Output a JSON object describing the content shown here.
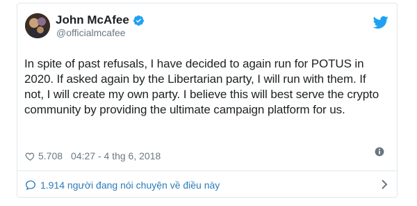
{
  "tweet": {
    "author_name": "John McAfee",
    "author_handle": "@officialmcafee",
    "text": "In spite of past refusals, I have decided to again run for POTUS in 2020. If asked again by the Libertarian party, I will run with them. If not, I will create my own party. I believe this will best serve the crypto community by providing the ultimate campaign platform for us.",
    "likes": "5.708",
    "timestamp": "04:27 - 4 thg 6, 2018",
    "conversation": "1.914 người đang nói chuyện về điều này"
  },
  "icons": {
    "verified": "verified-badge-icon",
    "brand": "twitter-bird-icon",
    "like": "heart-icon",
    "info": "info-icon",
    "reply": "speech-bubble-icon",
    "chevron": "chevron-right-icon"
  },
  "colors": {
    "accent": "#1da1f2",
    "link": "#2b7bb9",
    "muted": "#697882",
    "border": "#e1e8ed"
  }
}
